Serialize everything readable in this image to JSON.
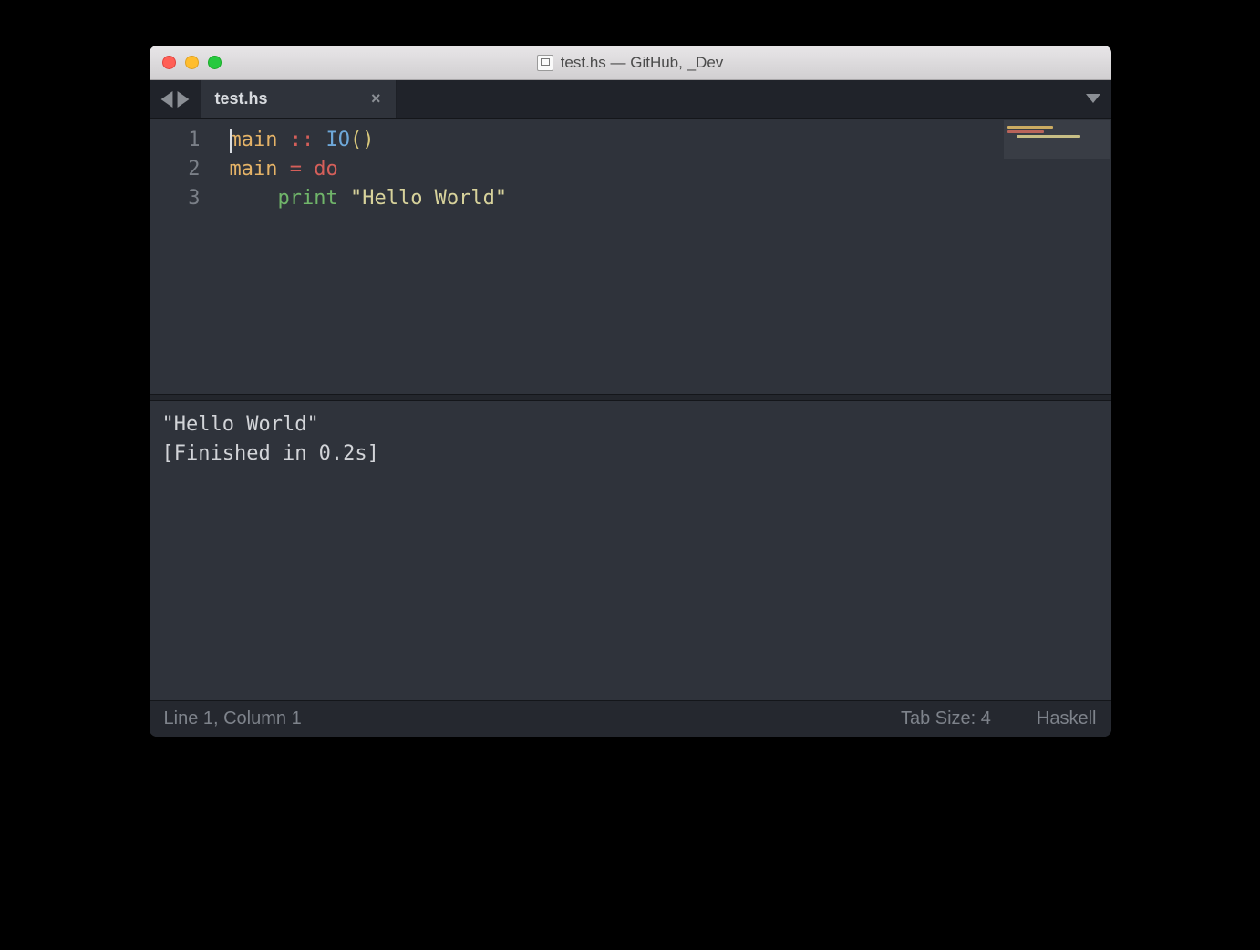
{
  "window": {
    "title": "test.hs — GitHub, _Dev"
  },
  "nav": {
    "back": "◀",
    "forward": "▶"
  },
  "tab": {
    "label": "test.hs",
    "close": "×"
  },
  "gutter": {
    "l1": "1",
    "l2": "2",
    "l3": "3"
  },
  "code": {
    "l1": {
      "main": "main",
      "dc": "::",
      "io": "IO",
      "lp": "(",
      "rp": ")"
    },
    "l2": {
      "main": "main",
      "eq": "=",
      "do": "do"
    },
    "l3": {
      "indent": "    ",
      "print": "print",
      "sp": " ",
      "str": "\"Hello World\""
    }
  },
  "console": {
    "out1": "\"Hello World\"",
    "out2": "[Finished in 0.2s]"
  },
  "status": {
    "pos": "Line 1, Column 1",
    "tab": "Tab Size: 4",
    "lang": "Haskell"
  }
}
